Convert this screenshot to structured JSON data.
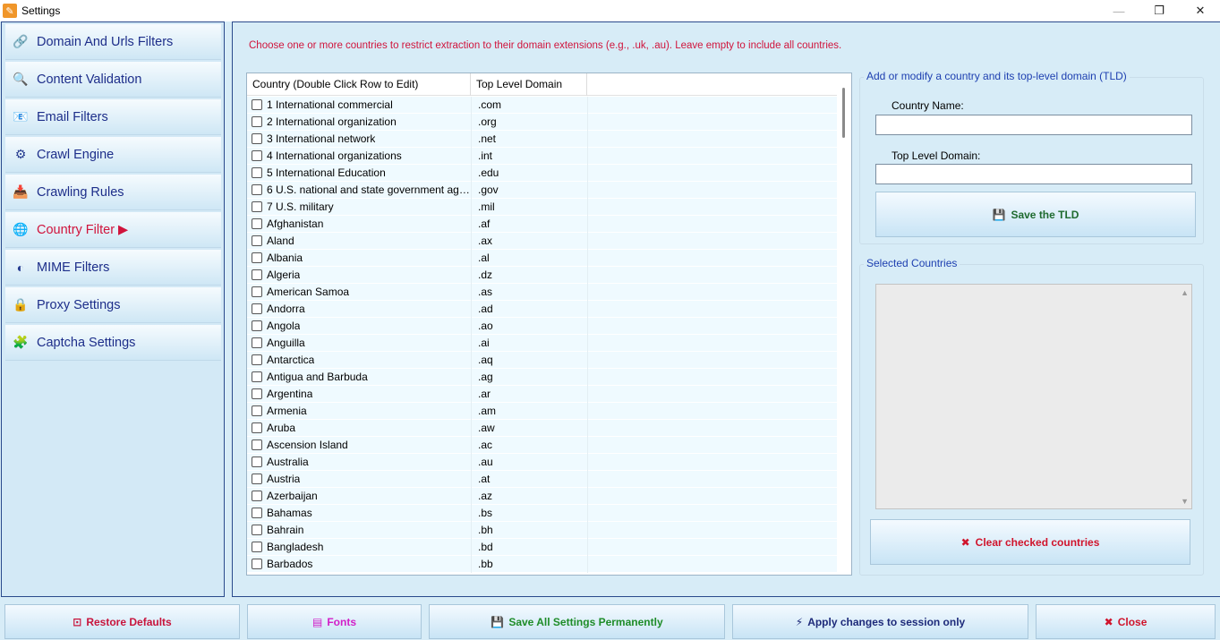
{
  "window": {
    "title": "Settings",
    "minimize": "—",
    "maximize": "❐",
    "close": "✕"
  },
  "sidebar": {
    "items": [
      {
        "label": "Domain And Urls Filters",
        "icon": "🔗",
        "active": false
      },
      {
        "label": "Content Validation",
        "icon": "🔍",
        "active": false
      },
      {
        "label": "Email Filters",
        "icon": "📧",
        "active": false
      },
      {
        "label": "Crawl Engine",
        "icon": "⚙",
        "active": false
      },
      {
        "label": "Crawling Rules",
        "icon": "📥",
        "active": false
      },
      {
        "label": "Country Filter ▶",
        "icon": "🌐",
        "active": true
      },
      {
        "label": "MIME Filters",
        "icon": "◐",
        "active": false
      },
      {
        "label": "Proxy Settings",
        "icon": "🔒",
        "active": false
      },
      {
        "label": "Captcha Settings",
        "icon": "🧩",
        "active": false
      }
    ]
  },
  "main": {
    "hint": "Choose one or more countries to restrict extraction to their domain extensions (e.g., .uk, .au). Leave empty to include all countries.",
    "table": {
      "columns": [
        "Country (Double Click Row to Edit)",
        "Top Level Domain"
      ],
      "rows": [
        [
          "1 International commercial",
          ".com"
        ],
        [
          "2 International organization",
          ".org"
        ],
        [
          "3 International network",
          ".net"
        ],
        [
          "4 International organizations",
          ".int"
        ],
        [
          "5 International Education",
          ".edu"
        ],
        [
          "6 U.S. national and state government age...",
          ".gov"
        ],
        [
          "7 U.S. military",
          ".mil"
        ],
        [
          "Afghanistan",
          ".af"
        ],
        [
          "Aland",
          ".ax"
        ],
        [
          "Albania",
          ".al"
        ],
        [
          "Algeria",
          ".dz"
        ],
        [
          "American Samoa",
          ".as"
        ],
        [
          "Andorra",
          ".ad"
        ],
        [
          "Angola",
          ".ao"
        ],
        [
          "Anguilla",
          ".ai"
        ],
        [
          "Antarctica",
          ".aq"
        ],
        [
          "Antigua and Barbuda",
          ".ag"
        ],
        [
          "Argentina",
          ".ar"
        ],
        [
          "Armenia",
          ".am"
        ],
        [
          "Aruba",
          ".aw"
        ],
        [
          "Ascension Island",
          ".ac"
        ],
        [
          "Australia",
          ".au"
        ],
        [
          "Austria",
          ".at"
        ],
        [
          "Azerbaijan",
          ".az"
        ],
        [
          "Bahamas",
          ".bs"
        ],
        [
          "Bahrain",
          ".bh"
        ],
        [
          "Bangladesh",
          ".bd"
        ],
        [
          "Barbados",
          ".bb"
        ]
      ]
    },
    "tld_group": {
      "title": "Add or modify a country and its top-level domain (TLD)",
      "country_label": "Country Name:",
      "country_value": "",
      "tld_label": "Top Level Domain:",
      "tld_value": "",
      "save_label": "Save the TLD",
      "save_icon": "💾"
    },
    "selected_group": {
      "title": "Selected Countries",
      "clear_label": "Clear checked countries",
      "clear_icon": "✖"
    }
  },
  "bottom": {
    "restore": {
      "label": "Restore Defaults",
      "icon": "⊡",
      "color": "#c8143c"
    },
    "fonts": {
      "label": "Fonts",
      "icon": "▤",
      "color": "#d21ec8"
    },
    "save_all": {
      "label": "Save All Settings Permanently",
      "icon": "💾",
      "color": "#1e8c28"
    },
    "apply": {
      "label": "Apply changes to session only",
      "icon": "⚡",
      "color": "#1d2a7a"
    },
    "close": {
      "label": "Close",
      "icon": "✖",
      "color": "#d0142c"
    }
  }
}
